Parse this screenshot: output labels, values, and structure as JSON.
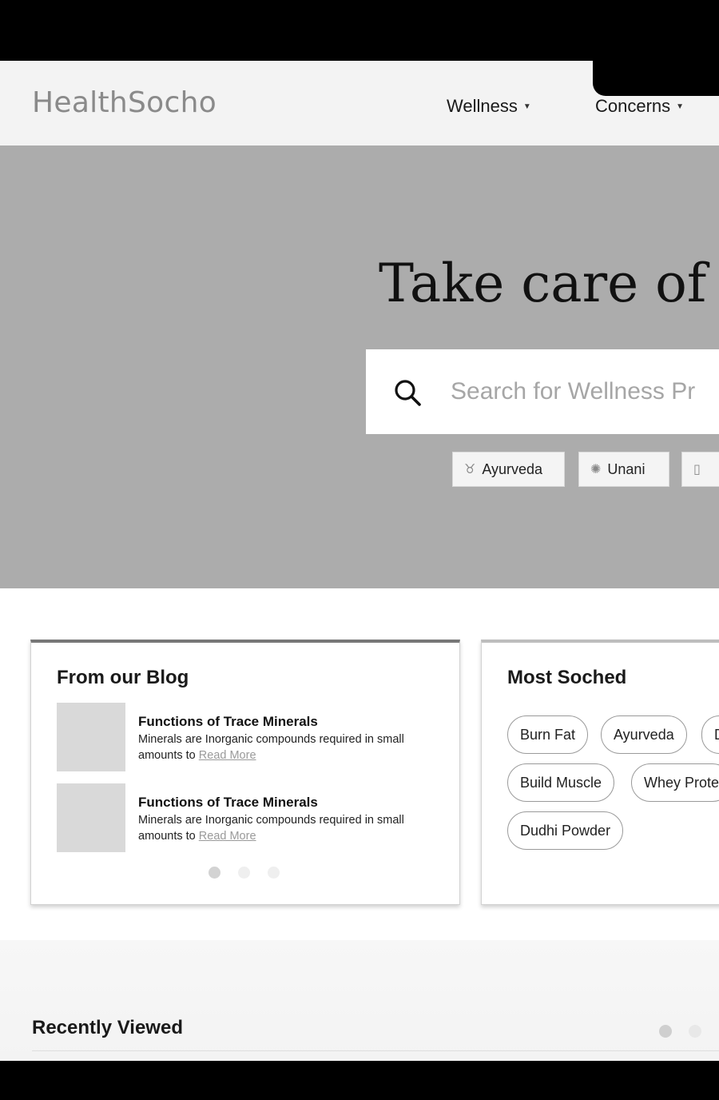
{
  "header": {
    "logo": "HealthSocho",
    "nav": [
      {
        "label": "Wellness"
      },
      {
        "label": "Concerns"
      }
    ]
  },
  "hero": {
    "title": "Take care of y",
    "search_placeholder": "Search for Wellness Pr",
    "chips": [
      {
        "label": "Ayurveda",
        "icon": "ayurveda-icon"
      },
      {
        "label": "Unani",
        "icon": "unani-icon"
      },
      {
        "label": "",
        "icon": "bottle-icon"
      }
    ]
  },
  "blog": {
    "title": "From our Blog",
    "items": [
      {
        "heading": "Functions of Trace Minerals",
        "text": "Minerals are Inorganic compounds required in small amounts to",
        "link": "Read More"
      },
      {
        "heading": "Functions of Trace Minerals",
        "text": "Minerals are Inorganic compounds required in small amounts to",
        "link": "Read More"
      }
    ]
  },
  "most_soched": {
    "title": "Most Soched",
    "tags": [
      "Burn Fat",
      "Ayurveda",
      "D",
      "Build Muscle",
      "Whey Prote",
      "Dudhi Powder"
    ]
  },
  "recently_viewed": {
    "title": "Recently Viewed"
  }
}
